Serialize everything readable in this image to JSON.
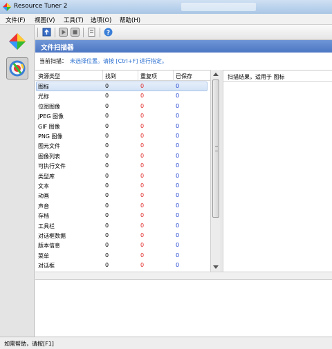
{
  "window": {
    "title": "Resource Tuner 2"
  },
  "menu": [
    "文件(F)",
    "视图(V)",
    "工具(T)",
    "选项(O)",
    "帮助(H)"
  ],
  "panel": {
    "title": "文件扫描器",
    "scan_label": "当前扫描：",
    "scan_hint": "未选择位置。请按 [Ctrl+F] 进行指定。"
  },
  "table": {
    "columns": [
      "资源类型",
      "找到",
      "重复项",
      "已保存"
    ],
    "rows": [
      {
        "type": "图标",
        "found": "0",
        "dup": "0",
        "saved": "0"
      },
      {
        "type": "光标",
        "found": "0",
        "dup": "0",
        "saved": "0"
      },
      {
        "type": "位图图像",
        "found": "0",
        "dup": "0",
        "saved": "0"
      },
      {
        "type": "JPEG 图像",
        "found": "0",
        "dup": "0",
        "saved": "0"
      },
      {
        "type": "GIF 图像",
        "found": "0",
        "dup": "0",
        "saved": "0"
      },
      {
        "type": "PNG 图像",
        "found": "0",
        "dup": "0",
        "saved": "0"
      },
      {
        "type": "图元文件",
        "found": "0",
        "dup": "0",
        "saved": "0"
      },
      {
        "type": "图像列表",
        "found": "0",
        "dup": "0",
        "saved": "0"
      },
      {
        "type": "可执行文件",
        "found": "0",
        "dup": "0",
        "saved": "0"
      },
      {
        "type": "类型库",
        "found": "0",
        "dup": "0",
        "saved": "0"
      },
      {
        "type": "文本",
        "found": "0",
        "dup": "0",
        "saved": "0"
      },
      {
        "type": "动画",
        "found": "0",
        "dup": "0",
        "saved": "0"
      },
      {
        "type": "声音",
        "found": "0",
        "dup": "0",
        "saved": "0"
      },
      {
        "type": "存档",
        "found": "0",
        "dup": "0",
        "saved": "0"
      },
      {
        "type": "工具栏",
        "found": "0",
        "dup": "0",
        "saved": "0"
      },
      {
        "type": "对话框数据",
        "found": "0",
        "dup": "0",
        "saved": "0"
      },
      {
        "type": "版本信息",
        "found": "0",
        "dup": "0",
        "saved": "0"
      },
      {
        "type": "菜单",
        "found": "0",
        "dup": "0",
        "saved": "0"
      },
      {
        "type": "对话框",
        "found": "0",
        "dup": "0",
        "saved": "0"
      }
    ],
    "selected_index": 0
  },
  "results": {
    "title": "扫描结果，适用于 图标"
  },
  "status": {
    "text": "如需帮助，请按[F1]"
  },
  "colors": {
    "found": "#000000",
    "dup": "#e02020",
    "saved": "#1a3fd0",
    "accent": "#4c76c4"
  },
  "icons": [
    "app-icon",
    "scan-icon",
    "play-icon",
    "stop-icon",
    "save-icon",
    "help-icon"
  ]
}
